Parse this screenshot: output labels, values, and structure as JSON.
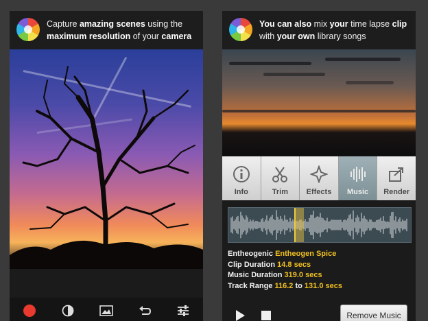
{
  "left": {
    "caption_parts": [
      "Capture ",
      "amazing scenes",
      " using the ",
      "maximum resolution",
      " of your ",
      "camera"
    ],
    "toolbar_icons": [
      "record-icon",
      "filter-icon",
      "gallery-icon",
      "undo-icon",
      "settings-sliders-icon"
    ]
  },
  "right": {
    "caption_parts": [
      "You can also ",
      "mix",
      " your ",
      "time lapse",
      " clip ",
      "with",
      " your own ",
      "library songs"
    ],
    "tools": [
      {
        "label": "Info",
        "icon": "info-icon"
      },
      {
        "label": "Trim",
        "icon": "scissors-icon"
      },
      {
        "label": "Effects",
        "icon": "effects-icon"
      },
      {
        "label": "Music",
        "icon": "music-waveform-icon"
      },
      {
        "label": "Render",
        "icon": "render-icon"
      }
    ],
    "info": {
      "artist": "Entheogenic",
      "track": "Entheogen Spice",
      "clip_label": "Clip Duration",
      "clip_value": "14.8 secs",
      "music_label": "Music Duration",
      "music_value": "319.0 secs",
      "range_label": "Track Range",
      "range_start": "116.2",
      "range_to": "to",
      "range_end": "131.0 secs"
    },
    "remove_music_label": "Remove Music"
  },
  "colors": {
    "accent_yellow": "#f0c020",
    "active_tool": "#7c9096"
  }
}
